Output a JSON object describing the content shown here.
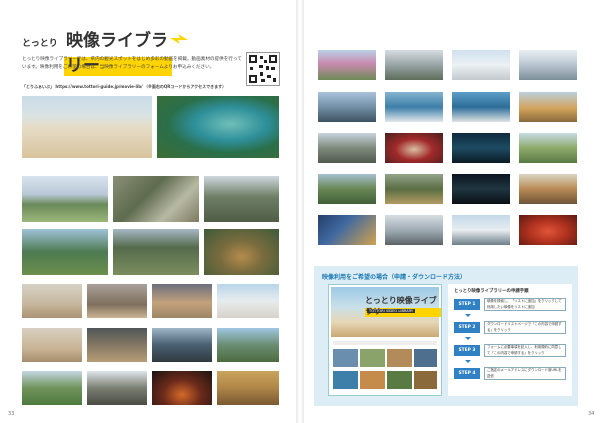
{
  "left": {
    "title_pre": "とっとり",
    "title_main": "映像ライブラリー",
    "intro": "とっとり映像ライブラリーでは、県内の観光スポットをはじめ多彩の動画を掲載。動画素材の提供を行っています。映像利用をご希望の場合は、当映像ライブラリーのフォームよりお申込みください。",
    "url": "「とりふぁいぶ」 https://www.tottori-guide.jp/movie-lib/ （※面右のQRコードからアクセスできます）",
    "page_number": "33"
  },
  "right": {
    "page_number": "34",
    "request_title": "映像利用をご希望の場合（申請・ダウンロード方法）",
    "steps_heading": "とっとり映像ライブラリーの申請手順",
    "steps": [
      {
        "label": "STEP 1",
        "text": "映像を検索し、「リストに追加」をクリックして利用したい映像をリストに追加"
      },
      {
        "label": "STEP 2",
        "text": "ダウンロードリストページで「この内容で申請する」をクリック"
      },
      {
        "label": "STEP 3",
        "text": "フォームに必要事項を記入し、利用規約に同意して「この内容で申請する」をクリック"
      },
      {
        "label": "STEP 4",
        "text": "ご指定のメールアドレスにダウンロード用URLを送信"
      }
    ],
    "screen_title": "とっとり映像ライブラリー",
    "screen_sub": "TOTTORI VIDEO LIBRARY"
  },
  "palette": {
    "accent_yellow": "#ffd400",
    "step_blue": "#2f80c4",
    "panel_blue": "#ddedf5"
  }
}
